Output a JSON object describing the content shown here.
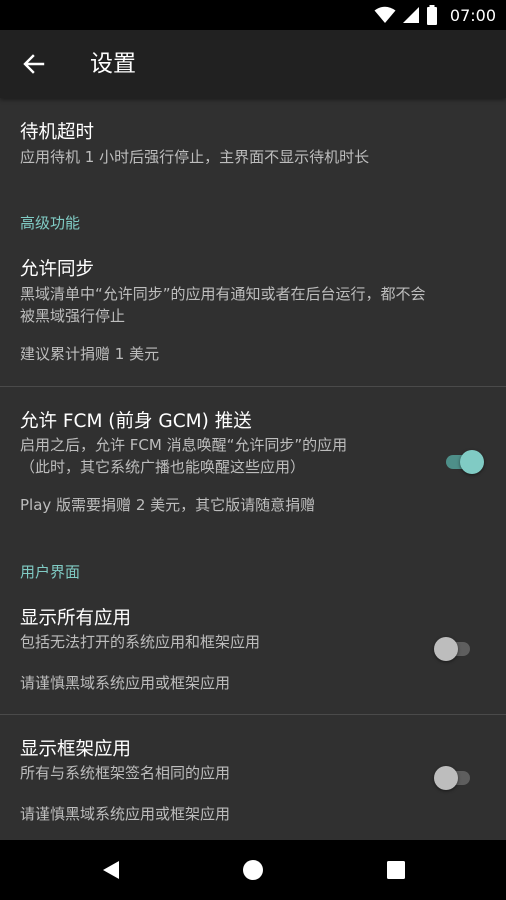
{
  "status_bar": {
    "time": "07:00",
    "icons": [
      "wifi-icon",
      "cell-signal-icon",
      "battery-icon"
    ]
  },
  "app_bar": {
    "title": "设置",
    "back_icon": "arrow-left-icon"
  },
  "settings": {
    "standby_timeout": {
      "title": "待机超时",
      "summary": "应用待机 1 小时后强行停止，主界面不显示待机时长"
    },
    "advanced_section": "高级功能",
    "allow_sync": {
      "title": "允许同步",
      "summary_line1": "黑域清单中“允许同步”的应用有通知或者在后台运行，都不会",
      "summary_line2": "被黑域强行停止",
      "note": "建议累计捐赠 1 美元"
    },
    "allow_fcm": {
      "title": "允许 FCM (前身 GCM) 推送",
      "summary_line1": "启用之后，允许 FCM 消息唤醒“允许同步”的应用",
      "summary_line2": "（此时，其它系统广播也能唤醒这些应用）",
      "note": "Play 版需要捐赠 2 美元，其它版请随意捐赠",
      "enabled": true
    },
    "ui_section": "用户界面",
    "show_all_apps": {
      "title": "显示所有应用",
      "summary": "包括无法打开的系统应用和框架应用",
      "note": "请谨慎黑域系统应用或框架应用",
      "enabled": false
    },
    "show_framework_apps": {
      "title": "显示框架应用",
      "summary": "所有与系统框架签名相同的应用",
      "note": "请谨慎黑域系统应用或框架应用",
      "enabled": false
    }
  },
  "colors": {
    "background": "#303030",
    "app_bar": "#212121",
    "accent": "#80cbc4",
    "secondary_text": "#bdbdbd"
  },
  "nav_bar": {
    "icons": [
      "back-triangle-icon",
      "home-circle-icon",
      "recents-square-icon"
    ]
  }
}
